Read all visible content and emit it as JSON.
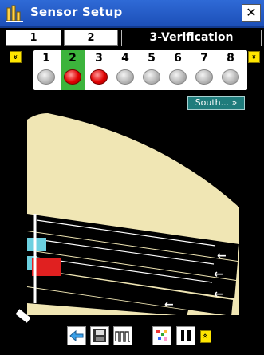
{
  "window": {
    "title": "Sensor Setup",
    "close_glyph": "✕"
  },
  "tabs": [
    {
      "label": "1",
      "active": false
    },
    {
      "label": "2",
      "active": false
    },
    {
      "label": "3-Verification",
      "active": true
    }
  ],
  "sensors": {
    "scroll_left_glyph": "»",
    "scroll_right_glyph": "»",
    "items": [
      {
        "number": "1",
        "state": "off"
      },
      {
        "number": "2",
        "state": "on"
      },
      {
        "number": "3",
        "state": "on"
      },
      {
        "number": "4",
        "state": "off"
      },
      {
        "number": "5",
        "state": "off"
      },
      {
        "number": "6",
        "state": "off"
      },
      {
        "number": "7",
        "state": "off"
      },
      {
        "number": "8",
        "state": "off"
      }
    ],
    "selected": "2"
  },
  "direction_button": {
    "label": "South... »"
  },
  "colors": {
    "zone": "#f0e6b4",
    "lane": "#000000",
    "vehicle_red": "#e02020",
    "vehicle_cyan": "#6cd0e0",
    "led_on": "#e00000",
    "selected_sensor": "#3cb43c",
    "title_bar": "#2f6ad6"
  },
  "toolbar": {
    "buttons": [
      "back-arrow-icon",
      "save-icon",
      "waveform-icon",
      "color-grid-icon",
      "pause-icon"
    ],
    "scroll_glyph": "»"
  }
}
